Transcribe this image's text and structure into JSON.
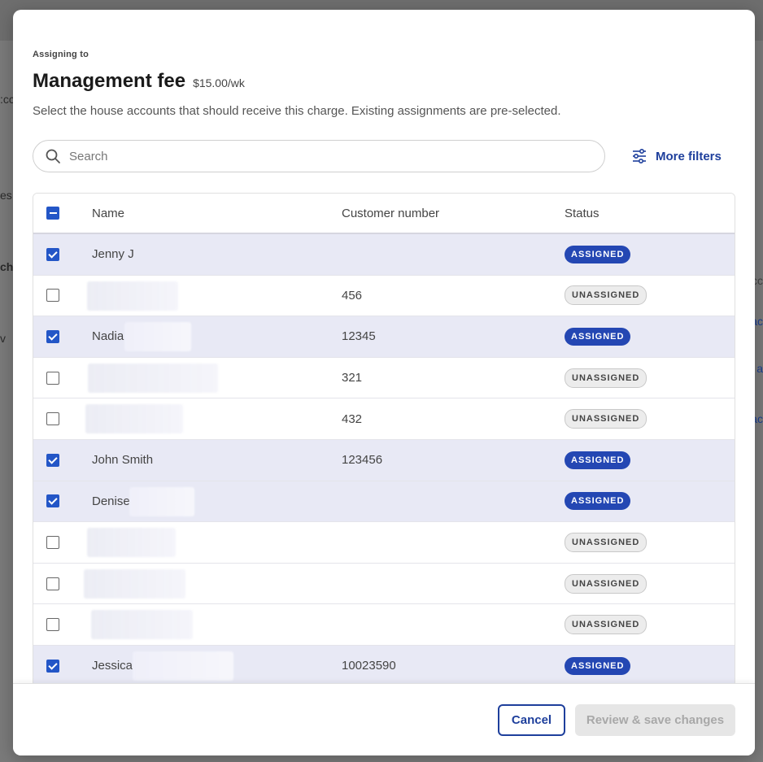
{
  "modal": {
    "eyebrow": "Assigning to",
    "title": "Management fee",
    "price": "$15.00/wk",
    "description": "Select the house accounts that should receive this charge. Existing assignments are pre-selected."
  },
  "search": {
    "placeholder": "Search"
  },
  "filters": {
    "label": "More filters"
  },
  "table": {
    "headers": {
      "name": "Name",
      "customer_number": "Customer number",
      "status": "Status"
    },
    "rows": [
      {
        "name": "Jenny J",
        "customer_number": "",
        "status": "ASSIGNED",
        "checked": true
      },
      {
        "name": "",
        "customer_number": "456",
        "status": "UNASSIGNED",
        "checked": false
      },
      {
        "name": "Nadia",
        "customer_number": "12345",
        "status": "ASSIGNED",
        "checked": true
      },
      {
        "name": "",
        "customer_number": "321",
        "status": "UNASSIGNED",
        "checked": false
      },
      {
        "name": "",
        "customer_number": "432",
        "status": "UNASSIGNED",
        "checked": false
      },
      {
        "name": "John Smith",
        "customer_number": "123456",
        "status": "ASSIGNED",
        "checked": true
      },
      {
        "name": "Denise",
        "customer_number": "",
        "status": "ASSIGNED",
        "checked": true
      },
      {
        "name": "",
        "customer_number": "",
        "status": "UNASSIGNED",
        "checked": false
      },
      {
        "name": "",
        "customer_number": "",
        "status": "UNASSIGNED",
        "checked": false
      },
      {
        "name": "",
        "customer_number": "",
        "status": "UNASSIGNED",
        "checked": false
      },
      {
        "name": "Jessica",
        "customer_number": "10023590",
        "status": "ASSIGNED",
        "checked": true
      }
    ]
  },
  "footer": {
    "cancel_label": "Cancel",
    "save_label": "Review & save changes"
  },
  "background": {
    "left_fragments": [
      ":cc",
      "es",
      "ch",
      "v"
    ],
    "right_fragments": [
      "cc",
      "ac",
      "a",
      "ac"
    ]
  },
  "colors": {
    "accent": "#2447b3",
    "selected_row": "#e8e9f5"
  }
}
